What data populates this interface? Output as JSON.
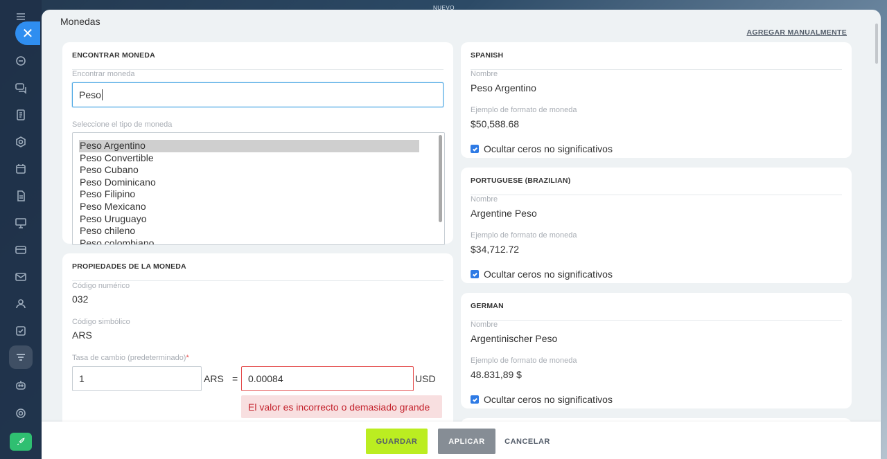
{
  "top_tag": "NUEVO",
  "title": "Monedas",
  "add_manual_label": "AGREGAR MANUALMENTE",
  "find": {
    "header": "ENCONTRAR MONEDA",
    "search_label": "Encontrar moneda",
    "search_value": "Peso",
    "type_label": "Seleccione el tipo de moneda",
    "options": [
      "Peso Argentino",
      "Peso Convertible",
      "Peso Cubano",
      "Peso Dominicano",
      "Peso Filipino",
      "Peso Mexicano",
      "Peso Uruguayo",
      "Peso chileno",
      "Peso colombiano"
    ],
    "selected": "Peso Argentino"
  },
  "props": {
    "header": "PROPIEDADES DE LA MONEDA",
    "numeric_code_label": "Código numérico",
    "numeric_code": "032",
    "symbolic_code_label": "Código simbólico",
    "symbolic_code": "ARS",
    "rate_label": "Tasa de cambio (predeterminado)",
    "required_mark": "*",
    "rate_amount": "1",
    "rate_currency": "ARS",
    "equals": "=",
    "rate_value": "0.00084",
    "base_currency": "USD",
    "error": "El valor es incorrecto o demasiado grande"
  },
  "langs": [
    {
      "header": "SPANISH",
      "name_label": "Nombre",
      "name": "Peso Argentino",
      "format_label": "Ejemplo de formato de moneda",
      "format": "$50,588.68",
      "hide_zeros": "Ocultar ceros no significativos"
    },
    {
      "header": "PORTUGUESE (BRAZILIAN)",
      "name_label": "Nombre",
      "name": "Argentine Peso",
      "format_label": "Ejemplo de formato de moneda",
      "format": "$34,712.72",
      "hide_zeros": "Ocultar ceros no significativos"
    },
    {
      "header": "GERMAN",
      "name_label": "Nombre",
      "name": "Argentinischer Peso",
      "format_label": "Ejemplo de formato de moneda",
      "format": "48.831,89 $",
      "hide_zeros": "Ocultar ceros no significativos"
    }
  ],
  "footer": {
    "save": "GUARDAR",
    "apply": "APLICAR",
    "cancel": "CANCELAR"
  },
  "colors": {
    "save_bg": "#bbed21",
    "apply_bg": "#868d95",
    "error_text": "#c4242e",
    "checkbox": "#2f7be5"
  }
}
